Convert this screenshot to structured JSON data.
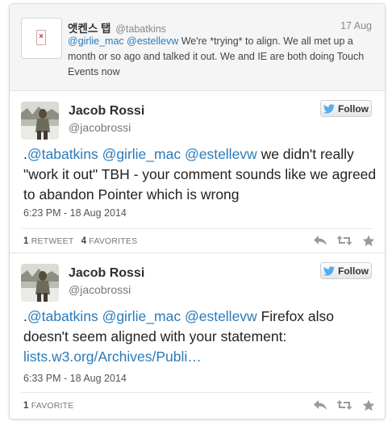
{
  "parent_tweet": {
    "display_name": "앳켄스 탭",
    "handle": "@tabatkins",
    "date": "17 Aug",
    "text_parts": [
      {
        "type": "mention",
        "text": "@girlie_mac"
      },
      {
        "type": "text",
        "text": " "
      },
      {
        "type": "mention",
        "text": "@estellevw"
      },
      {
        "type": "text",
        "text": " We're *trying* to align. We all met up a month or so ago and talked it out. We and IE are both doing Touch Events now"
      }
    ]
  },
  "tweets": [
    {
      "name": "Jacob Rossi",
      "handle": "@jacobrossi",
      "follow_label": "Follow",
      "text_parts": [
        {
          "type": "text",
          "text": "."
        },
        {
          "type": "mention",
          "text": "@tabatkins"
        },
        {
          "type": "text",
          "text": " "
        },
        {
          "type": "mention",
          "text": "@girlie_mac"
        },
        {
          "type": "text",
          "text": " "
        },
        {
          "type": "mention",
          "text": "@estellevw"
        },
        {
          "type": "text",
          "text": " we didn't really \"work it out\" TBH - your comment sounds like we agreed to abandon Pointer which is wrong"
        }
      ],
      "timestamp": "6:23 PM - 18 Aug 2014",
      "retweets_count": "1",
      "retweets_label": "RETWEET",
      "favorites_count": "4",
      "favorites_label": "FAVORITES"
    },
    {
      "name": "Jacob Rossi",
      "handle": "@jacobrossi",
      "follow_label": "Follow",
      "text_parts": [
        {
          "type": "text",
          "text": "."
        },
        {
          "type": "mention",
          "text": "@tabatkins"
        },
        {
          "type": "text",
          "text": " "
        },
        {
          "type": "mention",
          "text": "@girlie_mac"
        },
        {
          "type": "text",
          "text": " "
        },
        {
          "type": "mention",
          "text": "@estellevw"
        },
        {
          "type": "text",
          "text": " Firefox also doesn't seem aligned with your statement: "
        },
        {
          "type": "link",
          "text": "lists.w3.org/Archives/Publi…"
        }
      ],
      "timestamp": "6:33 PM - 18 Aug 2014",
      "favorites_count": "1",
      "favorites_label": "FAVORITE"
    }
  ],
  "colors": {
    "link": "#2b7bb9",
    "twitter_bird": "#55acee",
    "action_icons": "#9a9a9a"
  },
  "icons": [
    "broken-image-icon",
    "twitter-bird-icon",
    "reply-icon",
    "retweet-icon",
    "favorite-star-icon"
  ]
}
